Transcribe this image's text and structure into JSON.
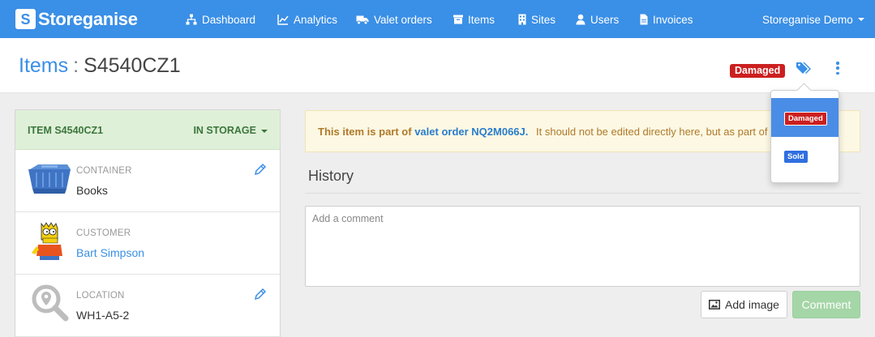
{
  "nav": {
    "brand": "Storeganise",
    "items": [
      {
        "label": "Dashboard",
        "icon": "sitemap-icon"
      },
      {
        "label": "Analytics",
        "icon": "line-chart-icon"
      },
      {
        "label": "Valet orders",
        "icon": "truck-icon"
      },
      {
        "label": "Items",
        "icon": "archive-icon"
      },
      {
        "label": "Sites",
        "icon": "building-icon"
      },
      {
        "label": "Users",
        "icon": "user-icon"
      },
      {
        "label": "Invoices",
        "icon": "file-invoice-icon"
      }
    ],
    "account": "Storeganise Demo"
  },
  "header": {
    "crumb": "Items",
    "separator": ":",
    "item_id": "S4540CZ1",
    "status_badge": "Damaged"
  },
  "panel": {
    "title": "ITEM S4540CZ1",
    "state": "IN STORAGE",
    "rows": [
      {
        "label": "CONTAINER",
        "value": "Books"
      },
      {
        "label": "CUSTOMER",
        "value": "Bart Simpson"
      },
      {
        "label": "LOCATION",
        "value": "WH1-A5-2"
      }
    ]
  },
  "alert": {
    "lead": "This item is part of",
    "order_link": "valet order NQ2M066J.",
    "rest": "It should not be edited directly here, but as part of the order"
  },
  "history": {
    "title": "History",
    "comment_placeholder": "Add a comment",
    "add_image_label": "Add image",
    "comment_label": "Comment"
  },
  "tag_menu": {
    "options": [
      "Damaged",
      "Sold"
    ],
    "selected": "Damaged"
  },
  "colors": {
    "primary": "#3a8fe6",
    "damaged": "#cc1f1f",
    "sold": "#2f6fe0",
    "success_bg": "#dff0d8",
    "warning_bg": "#fcf8e3"
  }
}
